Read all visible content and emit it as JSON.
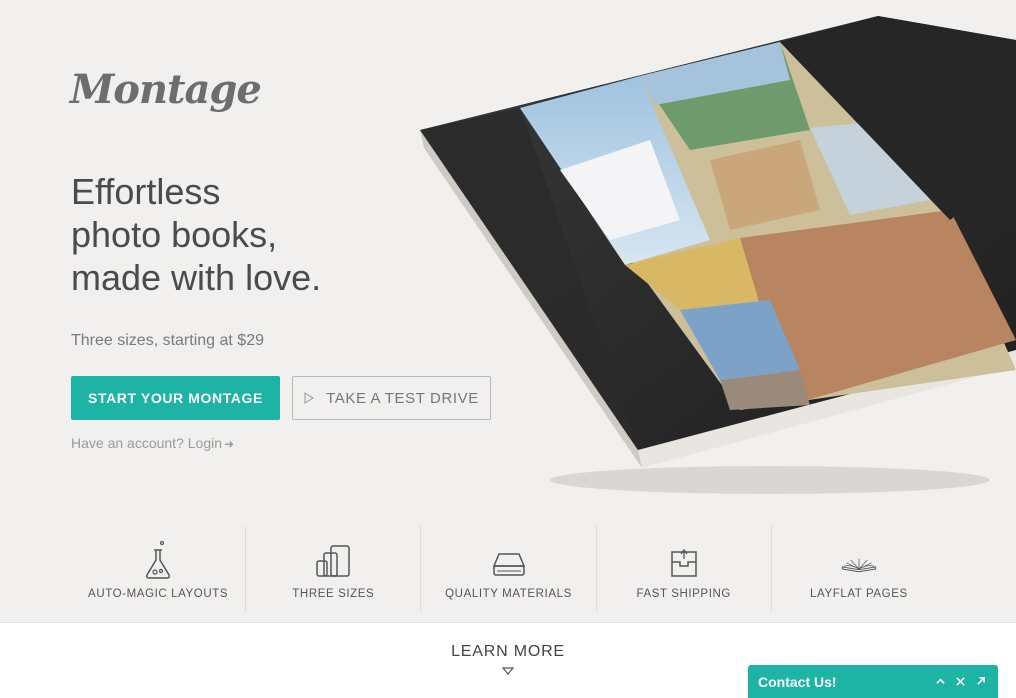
{
  "brand": {
    "logo_text": "Montage"
  },
  "hero": {
    "headline_lines": [
      "Effortless",
      "photo books,",
      "made with love."
    ],
    "subline": "Three sizes, starting at $29",
    "primary_button": "START YOUR MONTAGE",
    "secondary_button": "TAKE A TEST DRIVE",
    "login_prompt": "Have an account?",
    "login_link": "Login",
    "login_arrow": "➜"
  },
  "features": [
    {
      "label": "AUTO-MAGIC LAYOUTS",
      "icon": "flask-icon"
    },
    {
      "label": "THREE SIZES",
      "icon": "book-sizes-icon"
    },
    {
      "label": "QUALITY MATERIALS",
      "icon": "book-stack-icon"
    },
    {
      "label": "FAST SHIPPING",
      "icon": "shipping-box-icon"
    },
    {
      "label": "LAYFLAT PAGES",
      "icon": "open-book-icon"
    }
  ],
  "learn_more": {
    "label": "LEARN MORE"
  },
  "contact_widget": {
    "title": "Contact Us!",
    "controls": [
      "^",
      "✕",
      "↗"
    ]
  },
  "colors": {
    "accent": "#1db3a5",
    "background": "#f2f0ee",
    "text": "#4b4b4b"
  }
}
